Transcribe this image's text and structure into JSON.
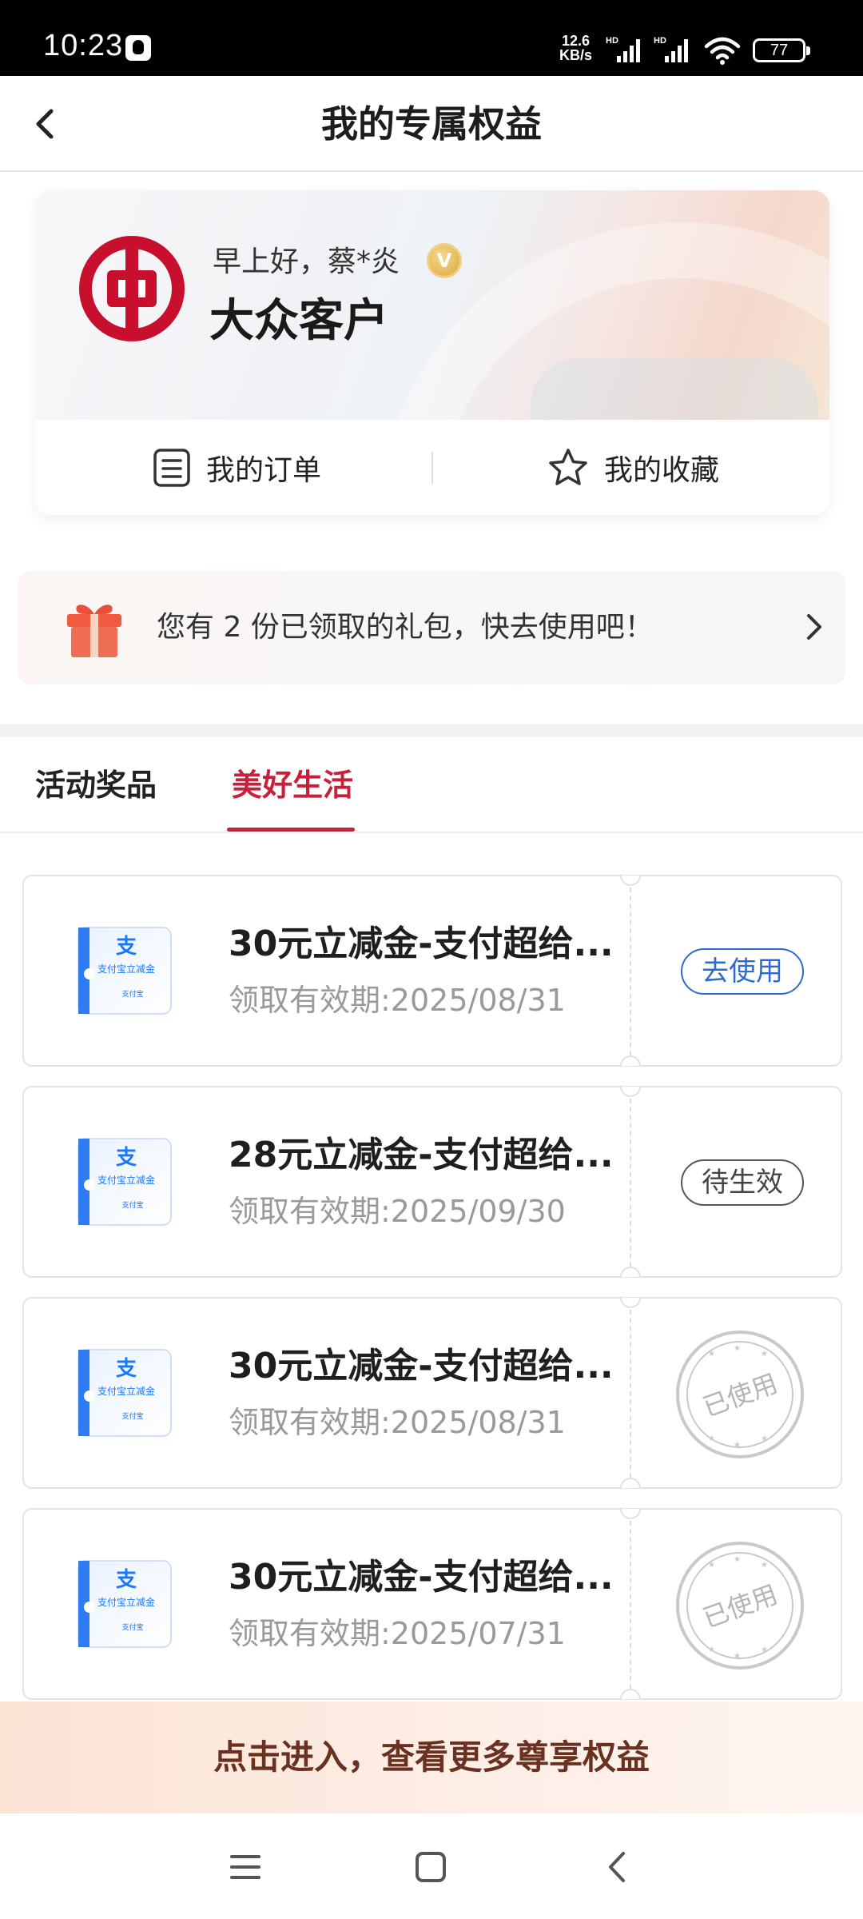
{
  "status_bar": {
    "time": "10:23",
    "net_speed_value": "12.6",
    "net_speed_unit": "KB/s",
    "sim1_label": "HD",
    "sim2_label": "HD",
    "battery": "77"
  },
  "header": {
    "title": "我的专属权益"
  },
  "profile": {
    "greeting": "早上好，蔡*炎",
    "vip_badge": "V",
    "level": "大众客户",
    "orders_label": "我的订单",
    "favorites_label": "我的收藏"
  },
  "gift_banner": {
    "text": "您有 2 份已领取的礼包，快去使用吧！"
  },
  "tabs": [
    {
      "label": "活动奖品",
      "active": false
    },
    {
      "label": "美好生活",
      "active": true
    }
  ],
  "coupon_thumb": {
    "glyph": "支",
    "line": "支付宝立减金",
    "brand": "支付宝"
  },
  "coupons": [
    {
      "name": "30元立减金-支付超给...",
      "validity": "领取有效期:2025/08/31",
      "status": "去使用"
    },
    {
      "name": "28元立减金-支付超给...",
      "validity": "领取有效期:2025/09/30",
      "status": "待生效"
    },
    {
      "name": "30元立减金-支付超给...",
      "validity": "领取有效期:2025/08/31",
      "status": "已使用"
    },
    {
      "name": "30元立减金-支付超给...",
      "validity": "领取有效期:2025/07/31",
      "status": "已使用"
    }
  ],
  "cta": {
    "label": "点击进入，查看更多尊享权益"
  },
  "colors": {
    "accent_red": "#c8203b",
    "use_blue": "#2f6ad0",
    "boc_red": "#c8102e"
  }
}
